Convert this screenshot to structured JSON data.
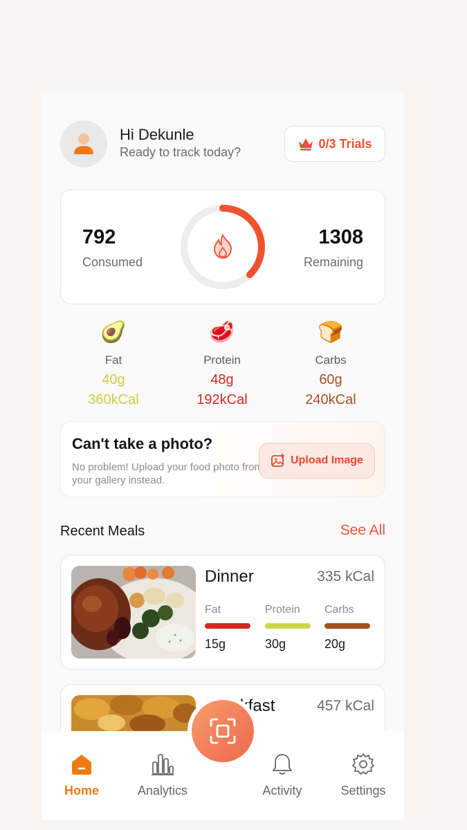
{
  "header": {
    "greeting": "Hi Dekunle",
    "subtitle": "Ready to track today?",
    "trials_label": "0/3 Trials"
  },
  "calories": {
    "consumed_value": "792",
    "consumed_label": "Consumed",
    "remaining_value": "1308",
    "remaining_label": "Remaining",
    "progress_fraction": 0.377
  },
  "macros": [
    {
      "emoji": "🥑",
      "name": "Fat",
      "grams": "40g",
      "kcal": "360kCal",
      "color": "#cccc4a"
    },
    {
      "emoji": "🥩",
      "name": "Protein",
      "grams": "48g",
      "kcal": "192kCal",
      "color": "#cf2a22"
    },
    {
      "emoji": "🍞",
      "name": "Carbs",
      "grams": "60g",
      "kcal": "240kCal",
      "color": "#a5521f"
    }
  ],
  "upload": {
    "title": "Can't take a photo?",
    "text": "No problem! Upload your food photo from your gallery instead.",
    "button_label": "Upload Image"
  },
  "recent": {
    "title": "Recent Meals",
    "see_all": "See All",
    "meals": [
      {
        "name": "Dinner",
        "kcal": "335 kCal",
        "macros": [
          {
            "label": "Fat",
            "value": "15g",
            "color": "#cf2a22"
          },
          {
            "label": "Protein",
            "value": "30g",
            "color": "#cfd451"
          },
          {
            "label": "Carbs",
            "value": "20g",
            "color": "#a5521f"
          }
        ]
      },
      {
        "name": "Breakfast",
        "kcal": "457 kCal"
      }
    ]
  },
  "nav": {
    "items": [
      {
        "label": "Home",
        "icon": "home-icon",
        "active": true
      },
      {
        "label": "Analytics",
        "icon": "analytics-icon"
      },
      {
        "label": "Activity",
        "icon": "bell-icon"
      },
      {
        "label": "Settings",
        "icon": "gear-icon"
      }
    ],
    "fab_icon": "scan-icon"
  },
  "colors": {
    "accent": "#f0522f",
    "nav_active": "#ef7a14"
  }
}
